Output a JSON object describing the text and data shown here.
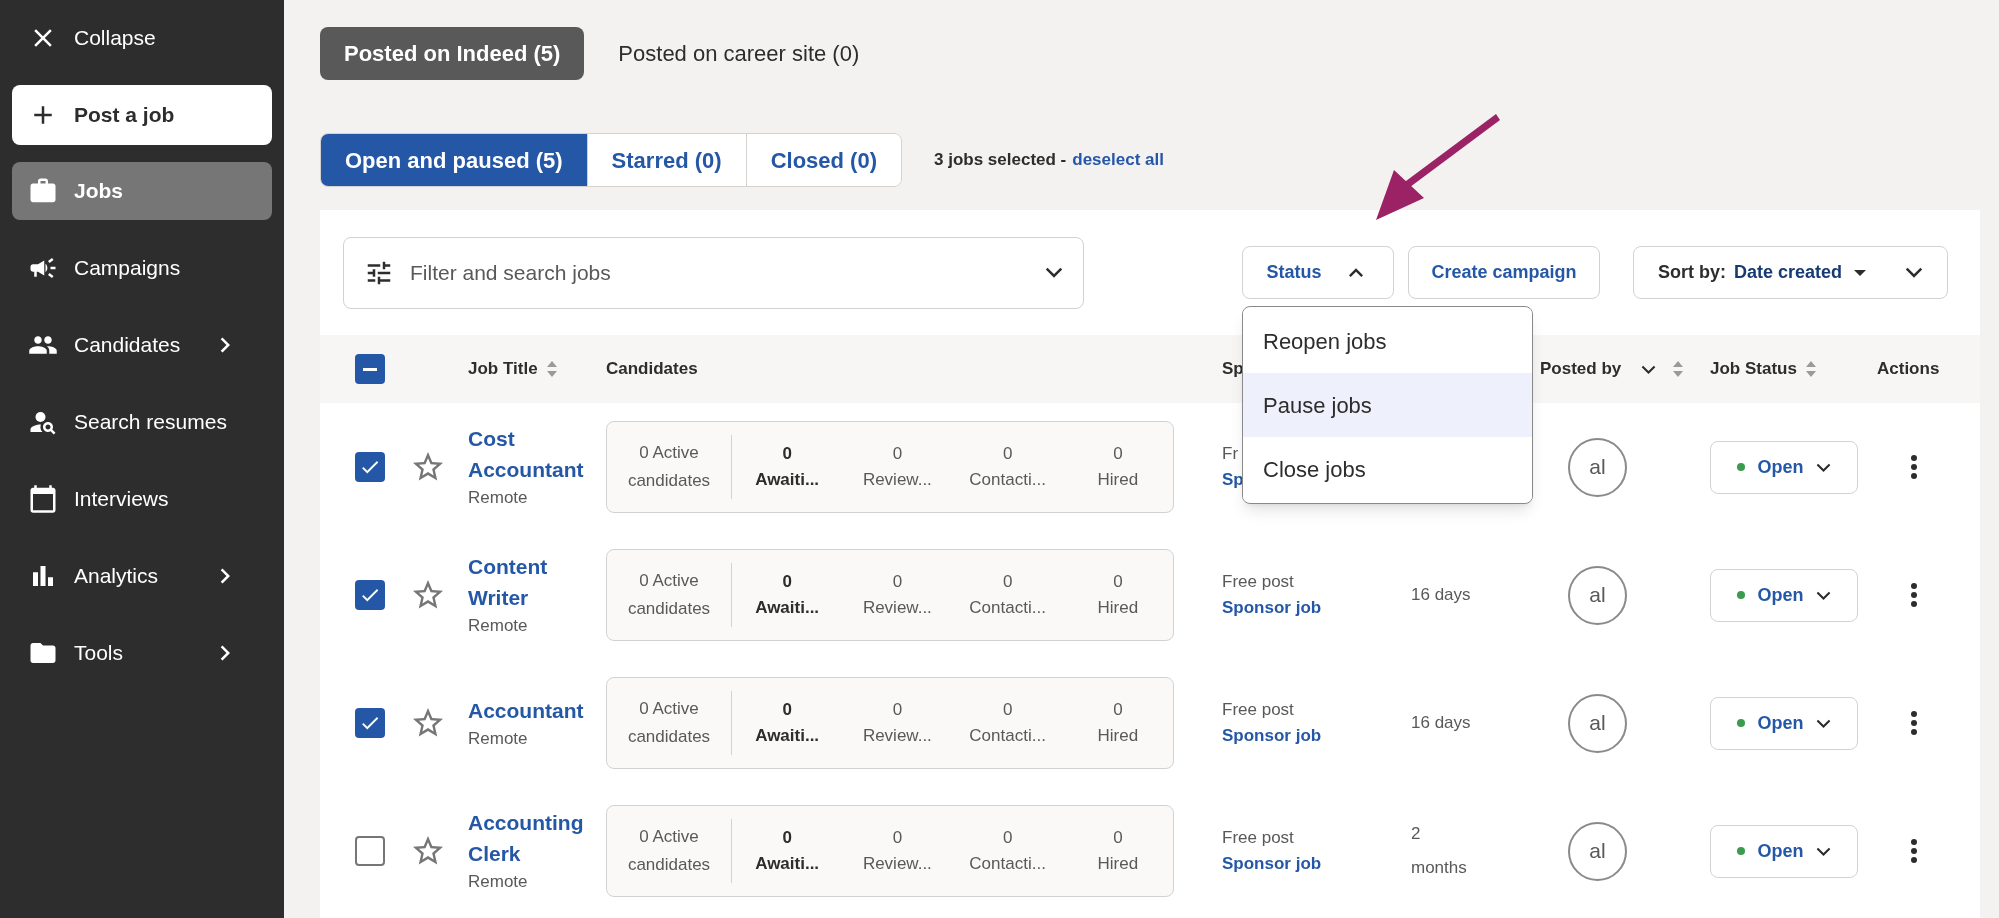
{
  "sidebar": {
    "collapse": {
      "label": "Collapse"
    },
    "post_button": {
      "label": "Post a job"
    },
    "items": [
      {
        "label": "Jobs",
        "selected": true,
        "expandable": false
      },
      {
        "label": "Campaigns",
        "selected": false,
        "expandable": false
      },
      {
        "label": "Candidates",
        "selected": false,
        "expandable": true
      },
      {
        "label": "Search resumes",
        "selected": false,
        "expandable": false
      },
      {
        "label": "Interviews",
        "selected": false,
        "expandable": false
      },
      {
        "label": "Analytics",
        "selected": false,
        "expandable": true
      },
      {
        "label": "Tools",
        "selected": false,
        "expandable": true
      }
    ]
  },
  "source_tabs": [
    {
      "label": "Posted on Indeed (5)",
      "selected": true
    },
    {
      "label": "Posted on career site (0)",
      "selected": false
    }
  ],
  "status_tabs": [
    {
      "label": "Open and paused (5)",
      "selected": true
    },
    {
      "label": "Starred (0)",
      "selected": false
    },
    {
      "label": "Closed (0)",
      "selected": false
    }
  ],
  "selection": {
    "text": "3 jobs selected -",
    "link": "deselect all"
  },
  "toolbar": {
    "filter": {
      "placeholder": "Filter and search jobs"
    },
    "status_button": {
      "label": "Status",
      "expanded": true
    },
    "create_campaign": {
      "label": "Create campaign"
    },
    "sort": {
      "label": "Sort by:",
      "value": "Date created"
    }
  },
  "status_menu": {
    "items": [
      {
        "label": "Reopen jobs",
        "highlighted": false
      },
      {
        "label": "Pause jobs",
        "highlighted": true
      },
      {
        "label": "Close jobs",
        "highlighted": false
      }
    ]
  },
  "table": {
    "select_all": {
      "indeterminate": true
    },
    "columns": [
      {
        "label": "Job Title",
        "sortable": true
      },
      {
        "label": "Candidates"
      },
      {
        "label": "Sp"
      },
      {
        "label": "Posted by",
        "sortable": true,
        "filterable": true
      },
      {
        "label": "Job Status",
        "sortable": true
      },
      {
        "label": "Actions"
      }
    ],
    "rows": [
      {
        "checked": true,
        "starred": false,
        "title": "Cost Accountant",
        "location": "Remote",
        "stats": [
          {
            "kind": "summary",
            "label": "0 Active candidates"
          },
          {
            "kind": "count",
            "count": "0",
            "label": "Awaiti...",
            "emphasis": true
          },
          {
            "kind": "count",
            "count": "0",
            "label": "Review...",
            "emphasis": false
          },
          {
            "kind": "count",
            "count": "0",
            "label": "Contacti...",
            "emphasis": false
          },
          {
            "kind": "count",
            "count": "0",
            "label": "Hired",
            "emphasis": false
          }
        ],
        "sponsor": {
          "text": "Fr",
          "link": "Sp"
        },
        "poster": "al",
        "status": "Open"
      },
      {
        "checked": true,
        "starred": false,
        "title": "Content Writer",
        "location": "Remote",
        "stats": [
          {
            "kind": "summary",
            "label": "0 Active candidates"
          },
          {
            "kind": "count",
            "count": "0",
            "label": "Awaiti...",
            "emphasis": true
          },
          {
            "kind": "count",
            "count": "0",
            "label": "Review...",
            "emphasis": false
          },
          {
            "kind": "count",
            "count": "0",
            "label": "Contacti...",
            "emphasis": false
          },
          {
            "kind": "count",
            "count": "0",
            "label": "Hired",
            "emphasis": false
          }
        ],
        "sponsor": {
          "text": "Free post",
          "link": "Sponsor job"
        },
        "age": "16 days",
        "poster": "al",
        "status": "Open"
      },
      {
        "checked": true,
        "starred": false,
        "title": "Accountant",
        "location": "Remote",
        "stats": [
          {
            "kind": "summary",
            "label": "0 Active candidates"
          },
          {
            "kind": "count",
            "count": "0",
            "label": "Awaiti...",
            "emphasis": true
          },
          {
            "kind": "count",
            "count": "0",
            "label": "Review...",
            "emphasis": false
          },
          {
            "kind": "count",
            "count": "0",
            "label": "Contacti...",
            "emphasis": false
          },
          {
            "kind": "count",
            "count": "0",
            "label": "Hired",
            "emphasis": false
          }
        ],
        "sponsor": {
          "text": "Free post",
          "link": "Sponsor job"
        },
        "age": "16 days",
        "poster": "al",
        "status": "Open"
      },
      {
        "checked": false,
        "starred": false,
        "title": "Accounting Clerk",
        "location": "Remote",
        "stats": [
          {
            "kind": "summary",
            "label": "0 Active candidates"
          },
          {
            "kind": "count",
            "count": "0",
            "label": "Awaiti...",
            "emphasis": true
          },
          {
            "kind": "count",
            "count": "0",
            "label": "Review...",
            "emphasis": false
          },
          {
            "kind": "count",
            "count": "0",
            "label": "Contacti...",
            "emphasis": false
          },
          {
            "kind": "count",
            "count": "0",
            "label": "Hired",
            "emphasis": false
          }
        ],
        "sponsor": {
          "text": "Free post",
          "link": "Sponsor job"
        },
        "age": "2 months",
        "poster": "al",
        "status": "Open"
      }
    ]
  }
}
